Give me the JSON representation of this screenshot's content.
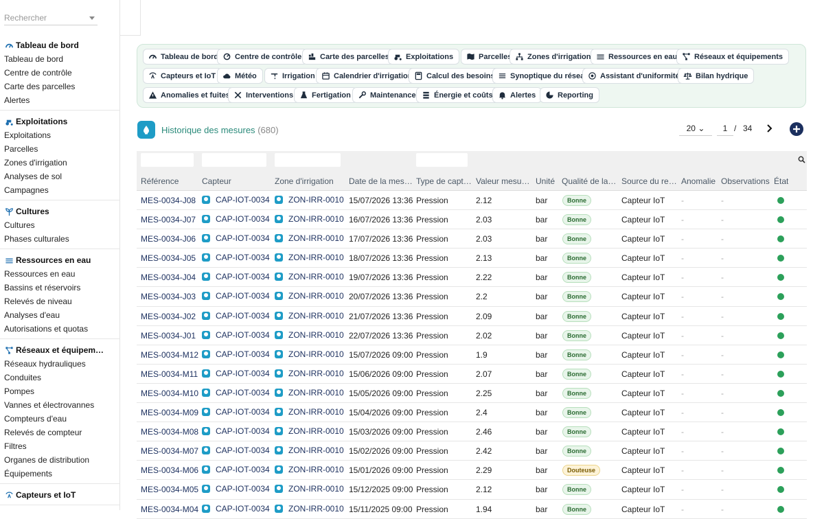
{
  "sidebar": {
    "search_placeholder": "Rechercher",
    "sections": [
      {
        "title": "Tableau de bord",
        "icon": "gauge-icon",
        "items": [
          "Tableau de bord",
          "Centre de contrôle",
          "Carte des parcelles",
          "Alertes"
        ]
      },
      {
        "title": "Exploitations",
        "icon": "tractor-icon",
        "items": [
          "Exploitations",
          "Parcelles",
          "Zones d'irrigation",
          "Analyses de sol",
          "Campagnes"
        ]
      },
      {
        "title": "Cultures",
        "icon": "sprout-icon",
        "items": [
          "Cultures",
          "Phases culturales"
        ]
      },
      {
        "title": "Ressources en eau",
        "icon": "water-icon",
        "items": [
          "Ressources en eau",
          "Bassins et réservoirs",
          "Relevés de niveau",
          "Analyses d'eau",
          "Autorisations et quotas"
        ]
      },
      {
        "title": "Réseaux et équipem…",
        "icon": "network-icon",
        "items": [
          "Réseaux hydrauliques",
          "Conduites",
          "Pompes",
          "Vannes et électrovannes",
          "Compteurs d'eau",
          "Relevés de compteur",
          "Filtres",
          "Organes de distribution",
          "Équipements"
        ]
      },
      {
        "title": "Capteurs et IoT",
        "icon": "sensor-icon",
        "items": []
      }
    ]
  },
  "chips": [
    {
      "label": "Tableau de bord",
      "icon": "gauge-icon"
    },
    {
      "label": "Centre de contrôle",
      "icon": "control-icon"
    },
    {
      "label": "Carte des parcelles",
      "icon": "map-icon"
    },
    {
      "label": "Exploitations",
      "icon": "tractor-icon"
    },
    {
      "label": "Parcelles",
      "icon": "map-fold-icon"
    },
    {
      "label": "Zones d'irrigation",
      "icon": "zones-icon"
    },
    {
      "label": "Ressources en eau",
      "icon": "water-icon"
    },
    {
      "label": "Réseaux et équipements",
      "icon": "network-icon"
    },
    {
      "label": "Capteurs et IoT",
      "icon": "sensor-icon"
    },
    {
      "label": "Météo",
      "icon": "cloud-icon"
    },
    {
      "label": "Irrigation",
      "icon": "faucet-icon"
    },
    {
      "label": "Calendrier d'irrigation",
      "icon": "calendar-icon"
    },
    {
      "label": "Calcul des besoins",
      "icon": "calculator-icon"
    },
    {
      "label": "Synoptique du réseau",
      "icon": "list-icon"
    },
    {
      "label": "Assistant d'uniformité",
      "icon": "target-icon"
    },
    {
      "label": "Bilan hydrique",
      "icon": "balance-icon"
    },
    {
      "label": "Anomalies et fuites",
      "icon": "warning-icon"
    },
    {
      "label": "Interventions",
      "icon": "tools-icon"
    },
    {
      "label": "Fertigation",
      "icon": "flask-icon"
    },
    {
      "label": "Maintenance",
      "icon": "wrench-icon"
    },
    {
      "label": "Énergie et coûts",
      "icon": "energy-icon"
    },
    {
      "label": "Alertes",
      "icon": "bell-icon"
    },
    {
      "label": "Reporting",
      "icon": "chart-pie-icon"
    }
  ],
  "header": {
    "title": "Historique des mesures",
    "count": "(680)"
  },
  "pagination": {
    "page_size": "20",
    "current": "1",
    "separator": "/",
    "total": "34"
  },
  "columns": [
    "Référence",
    "Capteur",
    "Zone d'irrigation",
    "Date de la mes…",
    "Type de capt…",
    "Valeur mesu…",
    "Unité",
    "Qualité de la…",
    "Source du re…",
    "Anomalie",
    "Observations",
    "État"
  ],
  "rows": [
    {
      "ref": "MES-0034-J08",
      "sensor": "CAP-IOT-0034",
      "zone": "ZON-IRR-0010",
      "date": "15/07/2026 13:36",
      "type": "Pression",
      "value": "2.12",
      "unit": "bar",
      "quality": "Bonne",
      "source": "Capteur IoT",
      "anomaly": "-",
      "obs": "-"
    },
    {
      "ref": "MES-0034-J07",
      "sensor": "CAP-IOT-0034",
      "zone": "ZON-IRR-0010",
      "date": "16/07/2026 13:36",
      "type": "Pression",
      "value": "2.03",
      "unit": "bar",
      "quality": "Bonne",
      "source": "Capteur IoT",
      "anomaly": "-",
      "obs": "-"
    },
    {
      "ref": "MES-0034-J06",
      "sensor": "CAP-IOT-0034",
      "zone": "ZON-IRR-0010",
      "date": "17/07/2026 13:36",
      "type": "Pression",
      "value": "2.03",
      "unit": "bar",
      "quality": "Bonne",
      "source": "Capteur IoT",
      "anomaly": "-",
      "obs": "-"
    },
    {
      "ref": "MES-0034-J05",
      "sensor": "CAP-IOT-0034",
      "zone": "ZON-IRR-0010",
      "date": "18/07/2026 13:36",
      "type": "Pression",
      "value": "2.13",
      "unit": "bar",
      "quality": "Bonne",
      "source": "Capteur IoT",
      "anomaly": "-",
      "obs": "-"
    },
    {
      "ref": "MES-0034-J04",
      "sensor": "CAP-IOT-0034",
      "zone": "ZON-IRR-0010",
      "date": "19/07/2026 13:36",
      "type": "Pression",
      "value": "2.22",
      "unit": "bar",
      "quality": "Bonne",
      "source": "Capteur IoT",
      "anomaly": "-",
      "obs": "-"
    },
    {
      "ref": "MES-0034-J03",
      "sensor": "CAP-IOT-0034",
      "zone": "ZON-IRR-0010",
      "date": "20/07/2026 13:36",
      "type": "Pression",
      "value": "2.2",
      "unit": "bar",
      "quality": "Bonne",
      "source": "Capteur IoT",
      "anomaly": "-",
      "obs": "-"
    },
    {
      "ref": "MES-0034-J02",
      "sensor": "CAP-IOT-0034",
      "zone": "ZON-IRR-0010",
      "date": "21/07/2026 13:36",
      "type": "Pression",
      "value": "2.09",
      "unit": "bar",
      "quality": "Bonne",
      "source": "Capteur IoT",
      "anomaly": "-",
      "obs": "-"
    },
    {
      "ref": "MES-0034-J01",
      "sensor": "CAP-IOT-0034",
      "zone": "ZON-IRR-0010",
      "date": "22/07/2026 13:36",
      "type": "Pression",
      "value": "2.02",
      "unit": "bar",
      "quality": "Bonne",
      "source": "Capteur IoT",
      "anomaly": "-",
      "obs": "-"
    },
    {
      "ref": "MES-0034-M12",
      "sensor": "CAP-IOT-0034",
      "zone": "ZON-IRR-0010",
      "date": "15/07/2026 09:00",
      "type": "Pression",
      "value": "1.9",
      "unit": "bar",
      "quality": "Bonne",
      "source": "Capteur IoT",
      "anomaly": "-",
      "obs": "-"
    },
    {
      "ref": "MES-0034-M11",
      "sensor": "CAP-IOT-0034",
      "zone": "ZON-IRR-0010",
      "date": "15/06/2026 09:00",
      "type": "Pression",
      "value": "2.07",
      "unit": "bar",
      "quality": "Bonne",
      "source": "Capteur IoT",
      "anomaly": "-",
      "obs": "-"
    },
    {
      "ref": "MES-0034-M10",
      "sensor": "CAP-IOT-0034",
      "zone": "ZON-IRR-0010",
      "date": "15/05/2026 09:00",
      "type": "Pression",
      "value": "2.25",
      "unit": "bar",
      "quality": "Bonne",
      "source": "Capteur IoT",
      "anomaly": "-",
      "obs": "-"
    },
    {
      "ref": "MES-0034-M09",
      "sensor": "CAP-IOT-0034",
      "zone": "ZON-IRR-0010",
      "date": "15/04/2026 09:00",
      "type": "Pression",
      "value": "2.4",
      "unit": "bar",
      "quality": "Bonne",
      "source": "Capteur IoT",
      "anomaly": "-",
      "obs": "-"
    },
    {
      "ref": "MES-0034-M08",
      "sensor": "CAP-IOT-0034",
      "zone": "ZON-IRR-0010",
      "date": "15/03/2026 09:00",
      "type": "Pression",
      "value": "2.46",
      "unit": "bar",
      "quality": "Bonne",
      "source": "Capteur IoT",
      "anomaly": "-",
      "obs": "-"
    },
    {
      "ref": "MES-0034-M07",
      "sensor": "CAP-IOT-0034",
      "zone": "ZON-IRR-0010",
      "date": "15/02/2026 09:00",
      "type": "Pression",
      "value": "2.42",
      "unit": "bar",
      "quality": "Bonne",
      "source": "Capteur IoT",
      "anomaly": "-",
      "obs": "-"
    },
    {
      "ref": "MES-0034-M06",
      "sensor": "CAP-IOT-0034",
      "zone": "ZON-IRR-0010",
      "date": "15/01/2026 09:00",
      "type": "Pression",
      "value": "2.29",
      "unit": "bar",
      "quality": "Douteuse",
      "source": "Capteur IoT",
      "anomaly": "-",
      "obs": "-"
    },
    {
      "ref": "MES-0034-M05",
      "sensor": "CAP-IOT-0034",
      "zone": "ZON-IRR-0010",
      "date": "15/12/2025 09:00",
      "type": "Pression",
      "value": "2.12",
      "unit": "bar",
      "quality": "Bonne",
      "source": "Capteur IoT",
      "anomaly": "-",
      "obs": "-"
    },
    {
      "ref": "MES-0034-M04",
      "sensor": "CAP-IOT-0034",
      "zone": "ZON-IRR-0010",
      "date": "15/11/2025 09:00",
      "type": "Pression",
      "value": "1.94",
      "unit": "bar",
      "quality": "Bonne",
      "source": "Capteur IoT",
      "anomaly": "-",
      "obs": "-"
    }
  ],
  "colors": {
    "accent": "#1b2f5e",
    "brand": "#1e9cc6",
    "ok": "#2ca05a",
    "chip_bg": "#eef7f1"
  }
}
